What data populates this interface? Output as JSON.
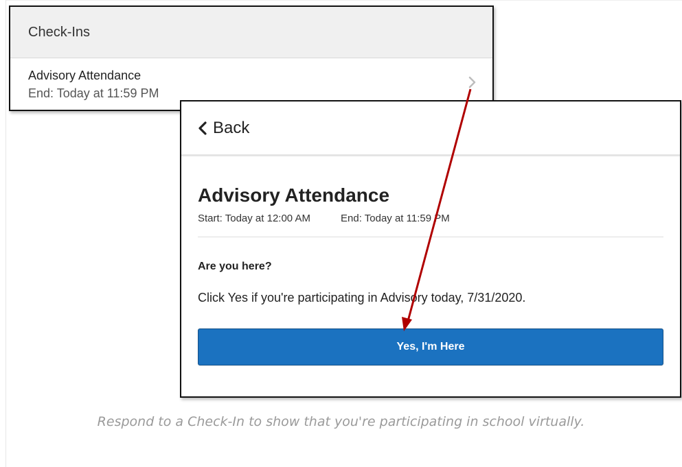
{
  "checkins": {
    "title": "Check-Ins",
    "item": {
      "title": "Advisory Attendance",
      "end": "End: Today at 11:59 PM",
      "icon": "chevron-right-icon"
    }
  },
  "detail": {
    "back_label": "Back",
    "back_icon": "chevron-left-icon",
    "title": "Advisory Attendance",
    "start": "Start: Today at 12:00 AM",
    "end": "End: Today at 11:59 PM",
    "question": "Are you here?",
    "instruction": "Click Yes if you're participating in Advisory today, 7/31/2020.",
    "button_label": "Yes, I'm Here",
    "button_color": "#1b72c0"
  },
  "caption": "Respond to a Check-In to show that you're participating in school virtually.",
  "annotation": {
    "arrow_color": "#b00000"
  }
}
